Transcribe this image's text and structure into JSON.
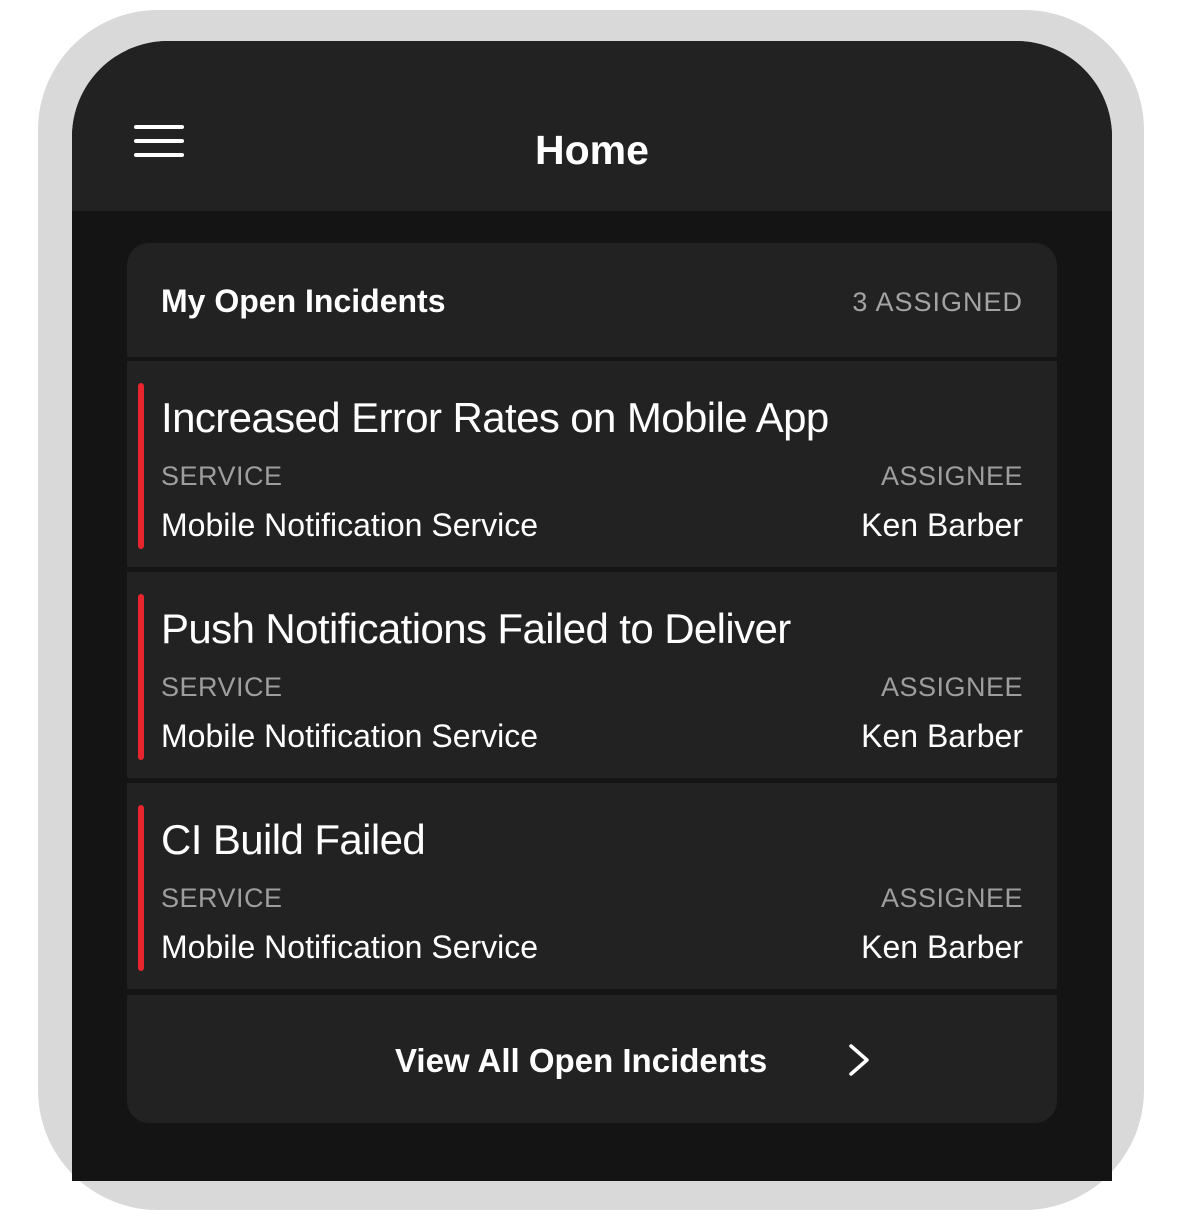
{
  "navbar": {
    "title": "Home"
  },
  "card": {
    "title": "My Open Incidents",
    "count": "3 ASSIGNED"
  },
  "incidents": [
    {
      "title": "Increased Error Rates on Mobile App",
      "service_label": "SERVICE",
      "service": "Mobile Notification Service",
      "assignee_label": "ASSIGNEE",
      "assignee": "Ken Barber"
    },
    {
      "title": "Push Notifications Failed to Deliver",
      "service_label": "SERVICE",
      "service": "Mobile Notification Service",
      "assignee_label": "ASSIGNEE",
      "assignee": "Ken Barber"
    },
    {
      "title": "CI Build Failed",
      "service_label": "SERVICE",
      "service": "Mobile Notification Service",
      "assignee_label": "ASSIGNEE",
      "assignee": "Ken Barber"
    }
  ],
  "footer": {
    "view_all_label": "View All Open Incidents"
  },
  "icons": {
    "menu": "hamburger-menu-icon",
    "chevron": "chevron-right-icon"
  },
  "colors": {
    "accent": "#e8242f",
    "background": "#141414",
    "surface": "#222222",
    "text": "#ffffff",
    "muted": "#9e9e9e"
  }
}
